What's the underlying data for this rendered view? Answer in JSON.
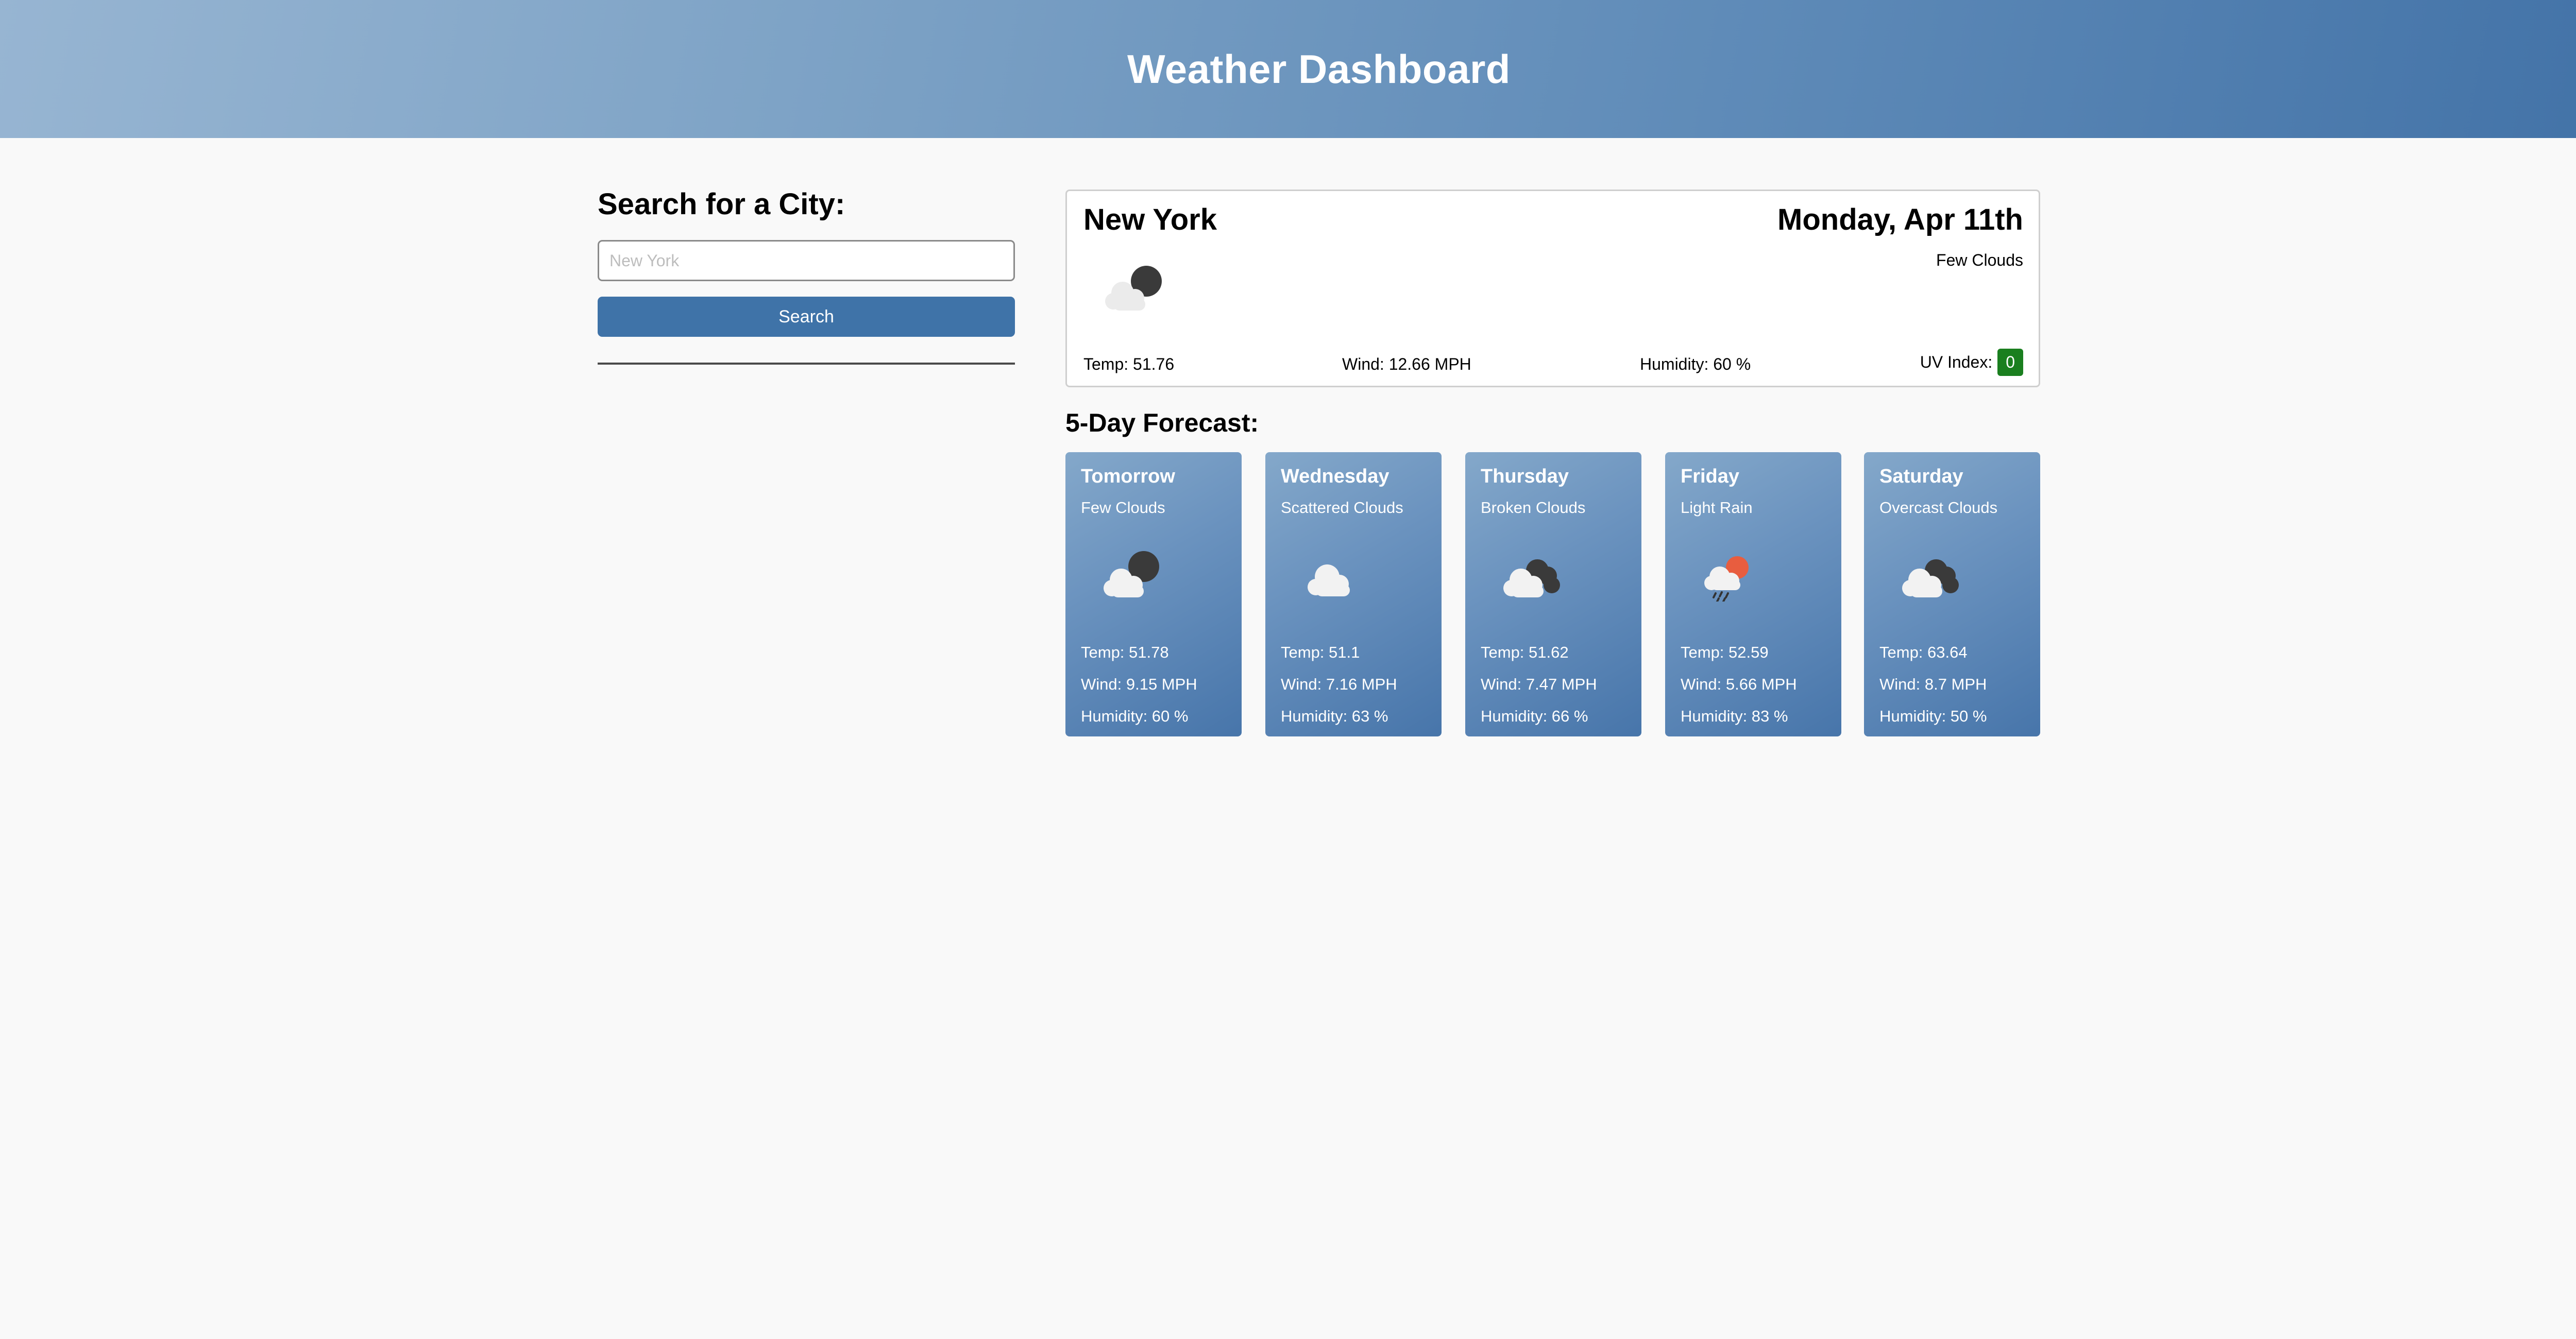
{
  "header": {
    "title": "Weather Dashboard"
  },
  "sidebar": {
    "heading": "Search for a City:",
    "search_placeholder": "New York",
    "search_value": "",
    "search_button": "Search"
  },
  "current": {
    "city": "New York",
    "date": "Monday, Apr 11th",
    "description": "Few Clouds",
    "icon": "few-clouds-night-icon",
    "temp": "Temp: 51.76",
    "wind": "Wind: 12.66 MPH",
    "humidity": "Humidity: 60 %",
    "uv_label": "UV Index:",
    "uv_value": "0",
    "uv_color": "#1a7f1f"
  },
  "forecast": {
    "title": "5-Day Forecast:",
    "days": [
      {
        "day": "Tomorrow",
        "condition": "Few Clouds",
        "icon": "few-clouds-night-icon",
        "temp": "Temp: 51.78",
        "wind": "Wind: 9.15 MPH",
        "humidity": "Humidity: 60 %"
      },
      {
        "day": "Wednesday",
        "condition": "Scattered Clouds",
        "icon": "scattered-clouds-icon",
        "temp": "Temp: 51.1",
        "wind": "Wind: 7.16 MPH",
        "humidity": "Humidity: 63 %"
      },
      {
        "day": "Thursday",
        "condition": "Broken Clouds",
        "icon": "broken-clouds-icon",
        "temp": "Temp: 51.62",
        "wind": "Wind: 7.47 MPH",
        "humidity": "Humidity: 66 %"
      },
      {
        "day": "Friday",
        "condition": "Light Rain",
        "icon": "light-rain-icon",
        "temp": "Temp: 52.59",
        "wind": "Wind: 5.66 MPH",
        "humidity": "Humidity: 83 %"
      },
      {
        "day": "Saturday",
        "condition": "Overcast Clouds",
        "icon": "overcast-clouds-icon",
        "temp": "Temp: 63.64",
        "wind": "Wind: 8.7 MPH",
        "humidity": "Humidity: 50 %"
      }
    ]
  },
  "colors": {
    "header_gradient_start": "#97b5d2",
    "header_gradient_end": "#4272a7",
    "button": "#3f73a8",
    "card_gradient_start": "#84a8ca",
    "card_gradient_end": "#4775aa",
    "background": "#f9f9f9"
  }
}
